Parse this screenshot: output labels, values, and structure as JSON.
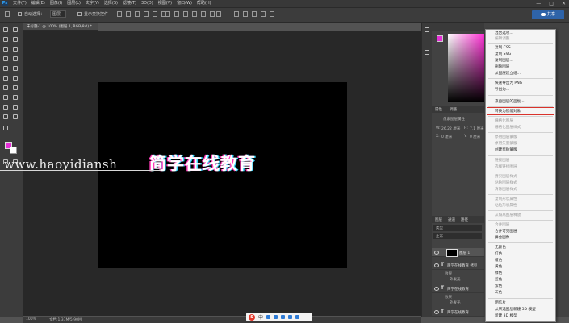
{
  "menubar": {
    "logo": "Ps",
    "items": [
      "文件(F)",
      "编辑(E)",
      "图像(I)",
      "图层(L)",
      "文字(Y)",
      "选择(S)",
      "滤镜(T)",
      "3D(D)",
      "视图(V)",
      "窗口(W)",
      "帮助(H)"
    ],
    "window_buttons": [
      "—",
      "□",
      "✕"
    ]
  },
  "options_bar": {
    "auto_select_label": "自动选择：",
    "auto_select_value": "图层",
    "show_transform_label": "显示变换控件",
    "share_button": "共享"
  },
  "document": {
    "tab_title": "未标题-1 @ 100% (图层 1, RGB/8#) *",
    "canvas_text": "简学在线教育",
    "watermark": "www.haoyidiansh"
  },
  "statusbar": {
    "zoom": "100%",
    "doc_info": "文档:1.37M/5.90M"
  },
  "ime_bar": {
    "logo": "S",
    "mode": "中"
  },
  "colors": {
    "foreground": "#e62fd8",
    "background": "#ffffff",
    "highlight_border": "#d9322b"
  },
  "properties_panel": {
    "tab1": "属性",
    "tab2": "调整",
    "title": "像素图层属性",
    "w_label": "W:",
    "w_value": "26.22 厘米",
    "h_label": "H:",
    "h_value": "7.1 厘米",
    "x_label": "X:",
    "x_value": "0 厘米",
    "y_label": "Y:",
    "y_value": "0 厘米"
  },
  "layers_panel": {
    "tab1": "图层",
    "tab2": "通道",
    "tab3": "路径",
    "kind_label": "类型",
    "blend_mode": "正常",
    "layers": [
      {
        "type": "pixel",
        "name": "图层 1"
      },
      {
        "type": "text",
        "name": "简学在线教育 拷贝"
      },
      {
        "type": "text",
        "name": "简学在线教育"
      },
      {
        "type": "text",
        "name": "简学在线教育"
      }
    ],
    "effects_label": "效果",
    "outer_glow_label": "外发光"
  },
  "context_menu": {
    "items": [
      {
        "label": "混合选项...",
        "enabled": true
      },
      {
        "label": "编辑调整...",
        "enabled": false
      },
      {
        "label": "复制 CSS",
        "enabled": true
      },
      {
        "label": "复制 SVG",
        "enabled": true
      },
      {
        "label": "复制图层...",
        "enabled": true
      },
      {
        "label": "删除图层",
        "enabled": true
      },
      {
        "label": "从图层建立组...",
        "enabled": true
      },
      {
        "label": "快速导出为 PNG",
        "enabled": true
      },
      {
        "label": "导出为...",
        "enabled": true
      },
      {
        "label": "来自图层的画板...",
        "enabled": true
      },
      {
        "label": "转换为智能对象",
        "enabled": true,
        "highlighted": true
      },
      {
        "label": "栅格化图层",
        "enabled": false
      },
      {
        "label": "栅格化图层样式",
        "enabled": false
      },
      {
        "label": "停用图层蒙版",
        "enabled": false
      },
      {
        "label": "停用矢量蒙版",
        "enabled": false
      },
      {
        "label": "创建剪贴蒙版",
        "enabled": true
      },
      {
        "label": "链接图层",
        "enabled": false
      },
      {
        "label": "选择链接图层",
        "enabled": false
      },
      {
        "label": "拷贝图层样式",
        "enabled": false
      },
      {
        "label": "粘贴图层样式",
        "enabled": false
      },
      {
        "label": "清除图层样式",
        "enabled": false
      },
      {
        "label": "复制形状属性",
        "enabled": false
      },
      {
        "label": "粘贴形状属性",
        "enabled": false
      },
      {
        "label": "从隔离图层释放",
        "enabled": false
      },
      {
        "label": "合并图层",
        "enabled": false
      },
      {
        "label": "合并可见图层",
        "enabled": true
      },
      {
        "label": "拼合图像",
        "enabled": true
      },
      {
        "label": "无颜色",
        "enabled": true
      },
      {
        "label": "红色",
        "enabled": true
      },
      {
        "label": "橙色",
        "enabled": true
      },
      {
        "label": "黄色",
        "enabled": true
      },
      {
        "label": "绿色",
        "enabled": true
      },
      {
        "label": "蓝色",
        "enabled": true
      },
      {
        "label": "紫色",
        "enabled": true
      },
      {
        "label": "灰色",
        "enabled": true
      },
      {
        "label": "明信片",
        "enabled": true
      },
      {
        "label": "从所选图层新建 3D 模型",
        "enabled": true
      },
      {
        "label": "新建 3D 模型",
        "enabled": true
      }
    ]
  }
}
